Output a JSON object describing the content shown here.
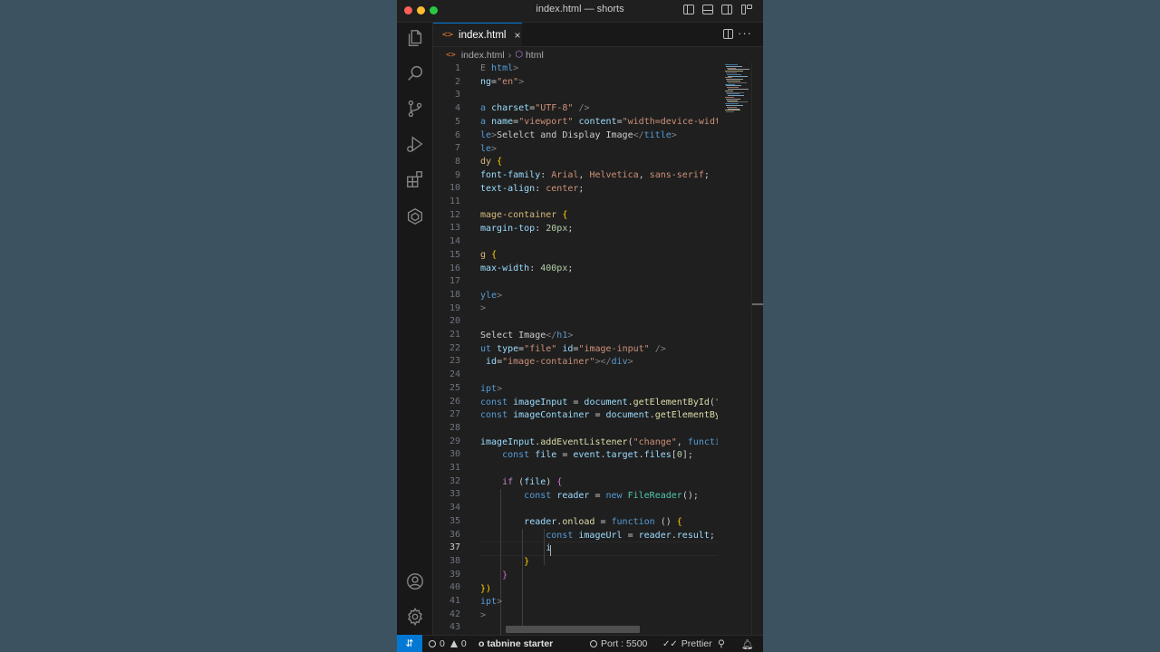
{
  "window": {
    "title": "index.html — shorts"
  },
  "tabs": [
    {
      "label": "index.html",
      "close": "×"
    }
  ],
  "breadcrumb": {
    "file": "index.html",
    "element": "html"
  },
  "editor": {
    "cursor_line": 37,
    "line_numbers": [
      "1",
      "2",
      "3",
      "4",
      "5",
      "6",
      "7",
      "8",
      "9",
      "10",
      "11",
      "12",
      "13",
      "14",
      "15",
      "16",
      "17",
      "18",
      "19",
      "20",
      "21",
      "22",
      "23",
      "24",
      "25",
      "26",
      "27",
      "28",
      "29",
      "30",
      "31",
      "32",
      "33",
      "34",
      "35",
      "36",
      "37",
      "38",
      "39",
      "40",
      "41",
      "42",
      "43"
    ]
  },
  "statusbar": {
    "errors": "0",
    "warnings": "0",
    "tabnine": "o tabnine starter",
    "port": "Port : 5500",
    "prettier": "Prettier"
  },
  "colors": {
    "accent": "#0078d4",
    "editor_bg": "#1f1f1f",
    "sidebar_bg": "#181818",
    "desktop_bg": "#3d5260"
  },
  "icons": {
    "activity_bar": [
      "files-icon",
      "search-icon",
      "source-control-icon",
      "run-debug-icon",
      "extensions-icon",
      "remote-explorer-icon",
      "account-icon",
      "settings-gear-icon"
    ]
  }
}
